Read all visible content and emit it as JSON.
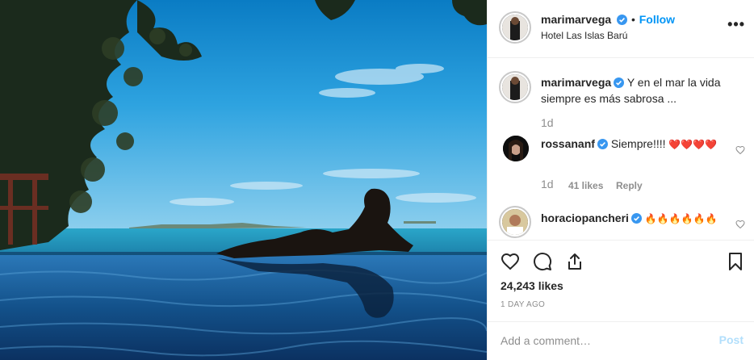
{
  "photo": {
    "alt_icon": "pool-sunset-photo"
  },
  "header": {
    "username": "marimarvega",
    "dot": "•",
    "follow_label": "Follow",
    "location": "Hotel Las Islas Barú",
    "more_label": "•••"
  },
  "caption": {
    "username": "marimarvega",
    "text": "Y en el mar la vida siempre es más sabrosa ...",
    "time": "1d"
  },
  "comments": [
    {
      "username": "rossananf",
      "text": "Siempre!!!! ",
      "emoji": "❤️❤️❤️❤️",
      "time": "1d",
      "likes": "41 likes",
      "reply": "Reply"
    },
    {
      "username": "horaciopancheri",
      "text": "",
      "emoji": "🔥🔥🔥🔥🔥🔥"
    }
  ],
  "actions": {
    "likes": "24,243 likes",
    "date": "1 DAY AGO"
  },
  "add_comment": {
    "placeholder": "Add a comment…",
    "post_label": "Post"
  },
  "colors": {
    "link": "#0095f6",
    "muted": "#8e8e8e",
    "post_disabled": "#b2dffc",
    "verified": "#3897f0"
  }
}
